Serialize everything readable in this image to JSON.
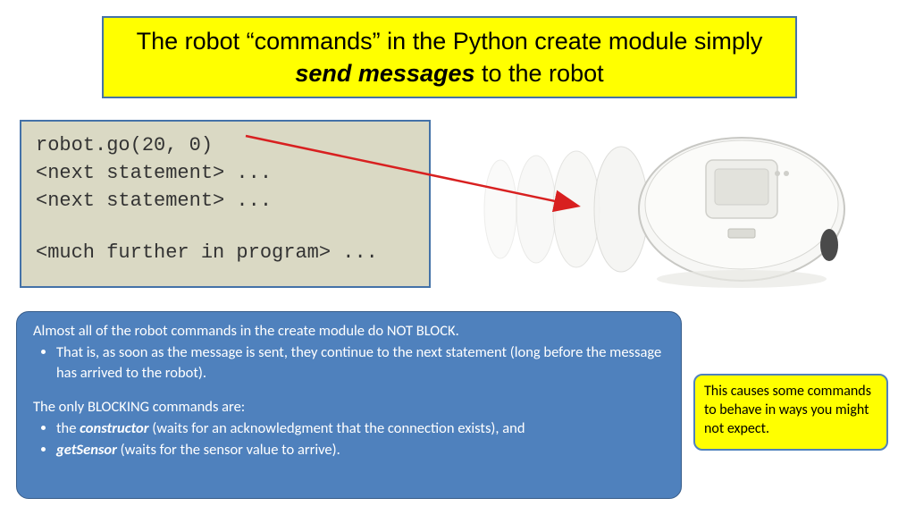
{
  "title": {
    "pre": "The robot “commands” in the Python create module simply ",
    "emph": "send messages",
    "post": " to the robot"
  },
  "code": {
    "line1": "robot.go(20, 0)",
    "line2": "<next statement> ...",
    "line3": "<next statement> ...",
    "line4": "<much further in program> ..."
  },
  "blue": {
    "p1": "Almost all of the robot commands in the create module do NOT BLOCK.",
    "b1": "That is, as soon as the message is sent, they continue to the next statement (long before the message has arrived to the robot).",
    "p2": "The only BLOCKING commands are:",
    "b2_pre": "the ",
    "b2_emph": "constructor",
    "b2_post": " (waits for an acknowledgment that the connection exists), and",
    "b3_emph": "getSensor",
    "b3_post": " (waits for the sensor value to arrive)."
  },
  "note": "This causes some commands to behave in ways you might not expect."
}
